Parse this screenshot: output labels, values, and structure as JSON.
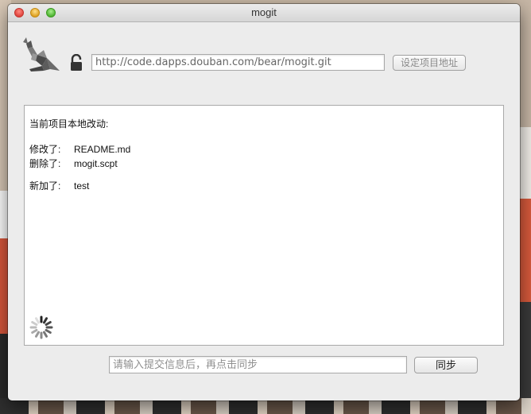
{
  "window": {
    "title": "mogit"
  },
  "header": {
    "logo_icon": "kangaroo-logo-icon",
    "lock_icon": "lock-icon",
    "repo_url": "http://code.dapps.douban.com/bear/mogit.git",
    "set_address_label": "设定项目地址"
  },
  "changes": {
    "heading": "当前项目本地改动:",
    "modified": {
      "label": "修改了:",
      "value": "README.md"
    },
    "deleted": {
      "label": "删除了:",
      "value": "mogit.scpt"
    },
    "added": {
      "label": "新加了:",
      "value": "test"
    }
  },
  "footer": {
    "commit_placeholder": "请输入提交信息后，再点击同步",
    "sync_label": "同步"
  },
  "colors": {
    "window_bg": "#ececec",
    "panel_bg": "#ffffff",
    "close": "#e0443e",
    "minimize": "#dea123",
    "maximize": "#4fb433"
  }
}
